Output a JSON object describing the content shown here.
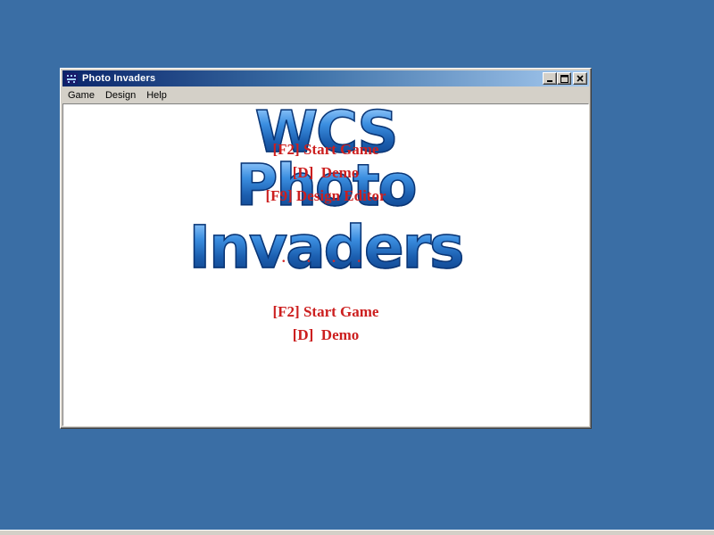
{
  "window": {
    "title": "Photo Invaders",
    "controls": {
      "minimize": "_",
      "maximize": "□",
      "close": "✕"
    }
  },
  "menubar": {
    "items": [
      {
        "label": "Game"
      },
      {
        "label": "Design"
      },
      {
        "label": "Help"
      }
    ]
  },
  "logo": {
    "line1": "WCS",
    "line2": "Photo",
    "line3": "Invaders"
  },
  "overlay_menu": {
    "start": "[F2] Start Game",
    "demo": "[D]  Demo",
    "design": "[F9] Design Editor",
    "dots": "• • • •"
  },
  "main_menu": {
    "start": "[F2] Start Game",
    "demo": "[D]  Demo"
  },
  "colors": {
    "desktop": "#3a6ea5",
    "menu_text": "#cc1f1f",
    "logo_blue": "#2a6fc0"
  },
  "icons": {
    "app": "invader-icon"
  }
}
